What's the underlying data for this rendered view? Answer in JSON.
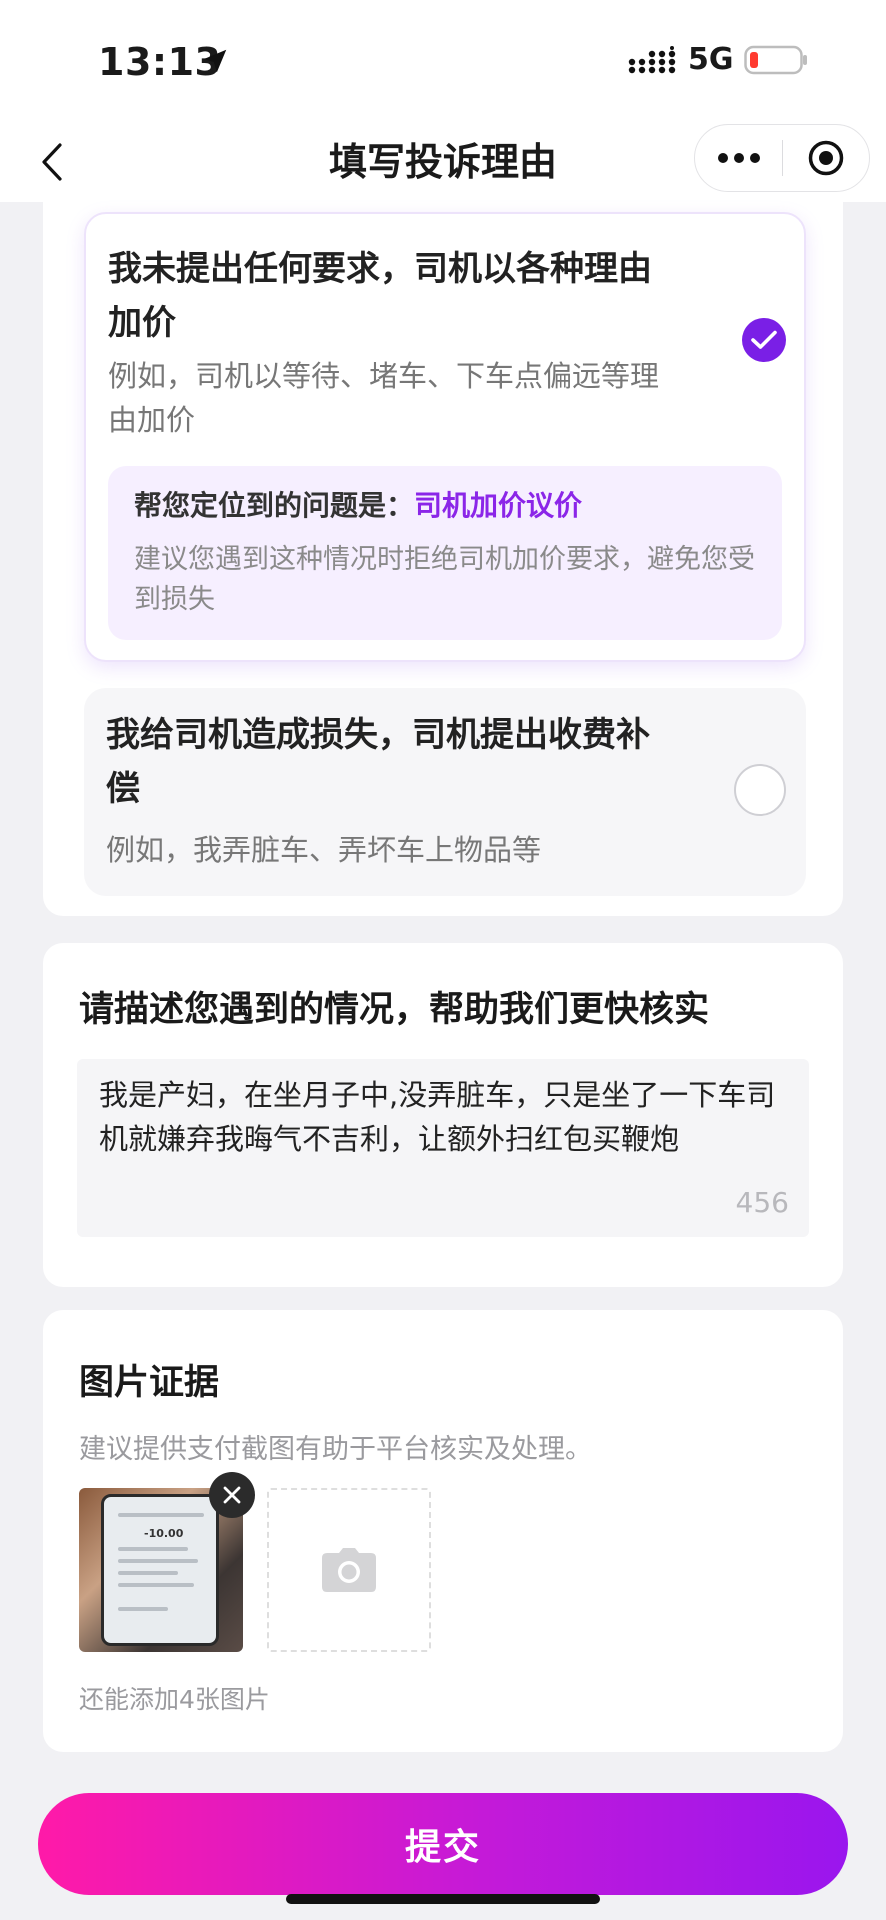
{
  "status_bar": {
    "time": "13:13",
    "network": "5G",
    "icons": [
      "location-arrow-icon",
      "signal-icon",
      "battery-icon"
    ],
    "battery_color": "#ff3b30"
  },
  "nav": {
    "title": "填写投诉理由",
    "icons": [
      "back-icon",
      "more-icon",
      "target-icon"
    ]
  },
  "options": [
    {
      "title": "我未提出任何要求，司机以各种理由加价",
      "desc": "例如，司机以等待、堵车、下车点偏远等理由加价",
      "selected": true,
      "hint_label": "帮您定位到的问题是：",
      "hint_value": "司机加价议价",
      "hint_text": "建议您遇到这种情况时拒绝司机加价要求，避免您受到损失"
    },
    {
      "title": "我给司机造成损失，司机提出收费补偿",
      "desc": "例如，我弄脏车、弄坏车上物品等",
      "selected": false
    }
  ],
  "description": {
    "title": "请描述您遇到的情况，帮助我们更快核实",
    "value": "我是产妇，在坐月子中,没弄脏车，只是坐了一下车司机就嫌弃我晦气不吉利，让额外扫红包买鞭炮",
    "remaining": "456"
  },
  "photos": {
    "title": "图片证据",
    "subtitle": "建议提供支付截图有助于平台核实及处理。",
    "thumb_amount": "-10.00",
    "remaining_text": "还能添加4张图片",
    "icons": [
      "close-icon",
      "camera-icon"
    ]
  },
  "submit": {
    "label": "提交"
  },
  "colors": {
    "accent_purple": "#7a1fe6",
    "hint_purple": "#8b26e8",
    "submit_gradient_start": "#ff1aa8",
    "submit_gradient_end": "#9a16ee",
    "page_bg": "#f1f1f4"
  }
}
